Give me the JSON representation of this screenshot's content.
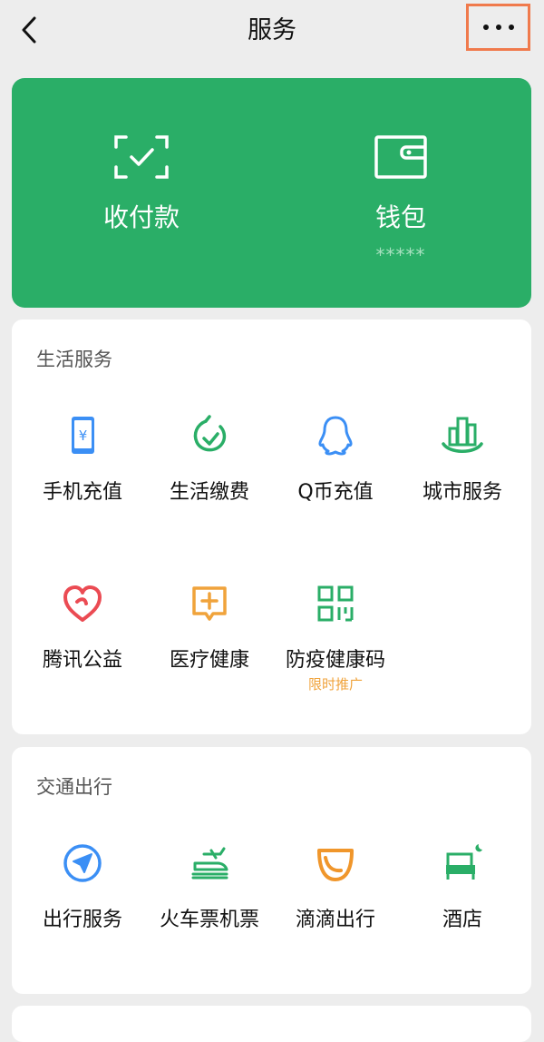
{
  "header": {
    "title": "服务"
  },
  "wallet": {
    "pay": {
      "label": "收付款"
    },
    "purse": {
      "label": "钱包",
      "balance": "*****"
    }
  },
  "life": {
    "title": "生活服务",
    "items": [
      {
        "label": "手机充值",
        "icon": "phone-topup-icon"
      },
      {
        "label": "生活缴费",
        "icon": "utility-payment-icon"
      },
      {
        "label": "Q币充值",
        "icon": "qq-coin-icon"
      },
      {
        "label": "城市服务",
        "icon": "city-services-icon"
      },
      {
        "label": "腾讯公益",
        "icon": "charity-heart-icon"
      },
      {
        "label": "医疗健康",
        "icon": "medical-cross-icon"
      },
      {
        "label": "防疫健康码",
        "icon": "qr-code-icon",
        "promo": "限时推广"
      }
    ]
  },
  "transport": {
    "title": "交通出行",
    "items": [
      {
        "label": "出行服务",
        "icon": "navigation-arrow-icon"
      },
      {
        "label": "火车票机票",
        "icon": "train-plane-icon"
      },
      {
        "label": "滴滴出行",
        "icon": "didi-icon"
      },
      {
        "label": "酒店",
        "icon": "hotel-bed-icon"
      }
    ]
  },
  "colors": {
    "brand_green": "#2aae67",
    "highlight": "#f07a4c",
    "promo": "#f0a33b"
  }
}
